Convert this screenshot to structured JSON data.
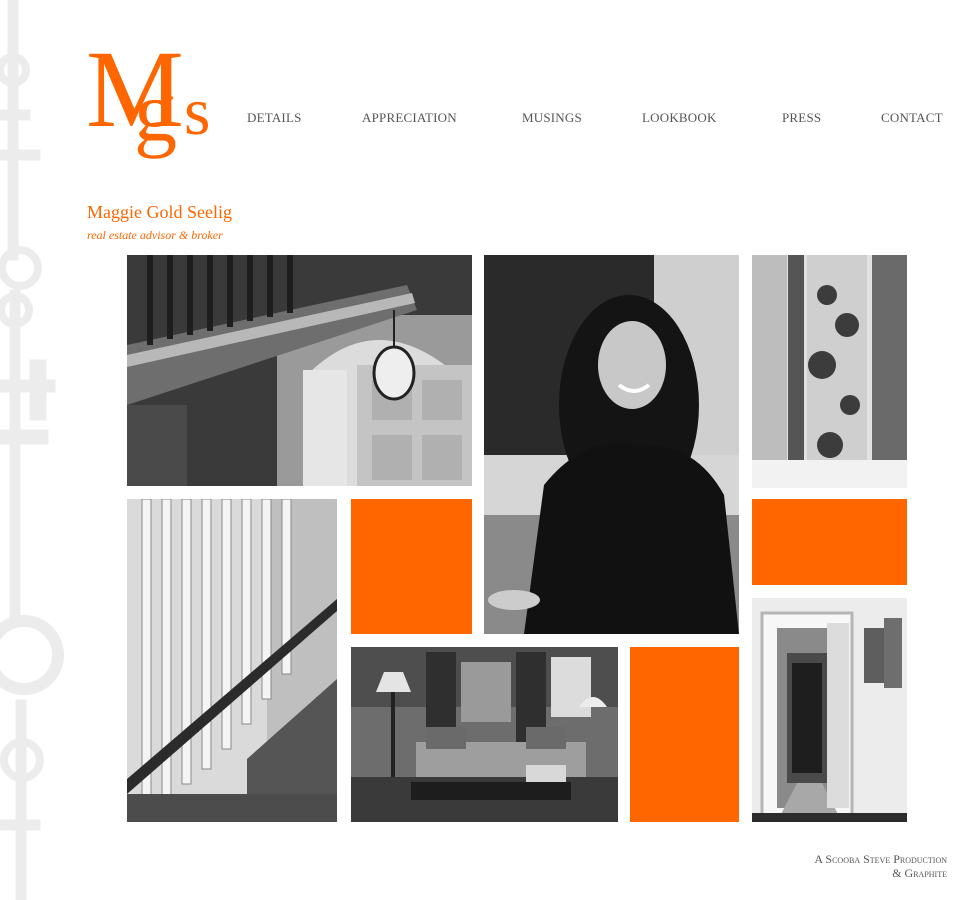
{
  "brand": {
    "monogram": "Mgs",
    "name": "Maggie Gold Seelig",
    "tagline": "real estate advisor & broker",
    "accent_color": "#ff6600"
  },
  "nav": {
    "items": [
      {
        "label": "DETAILS"
      },
      {
        "label": "APPRECIATION"
      },
      {
        "label": "MUSINGS"
      },
      {
        "label": "LOOKBOOK"
      },
      {
        "label": "PRESS"
      },
      {
        "label": "CONTACT"
      }
    ]
  },
  "gallery": {
    "photos": [
      {
        "icon": "staircase-lantern-photo"
      },
      {
        "icon": "portrait-photo"
      },
      {
        "icon": "toile-wallpaper-photo"
      },
      {
        "icon": "staircase-balusters-photo"
      },
      {
        "icon": "living-room-photo"
      },
      {
        "icon": "hallway-photo"
      }
    ],
    "accent_color": "#ff6600"
  },
  "footer": {
    "credit_line1": "A Scooba Steve Production",
    "credit_line2": "& Graphite"
  }
}
